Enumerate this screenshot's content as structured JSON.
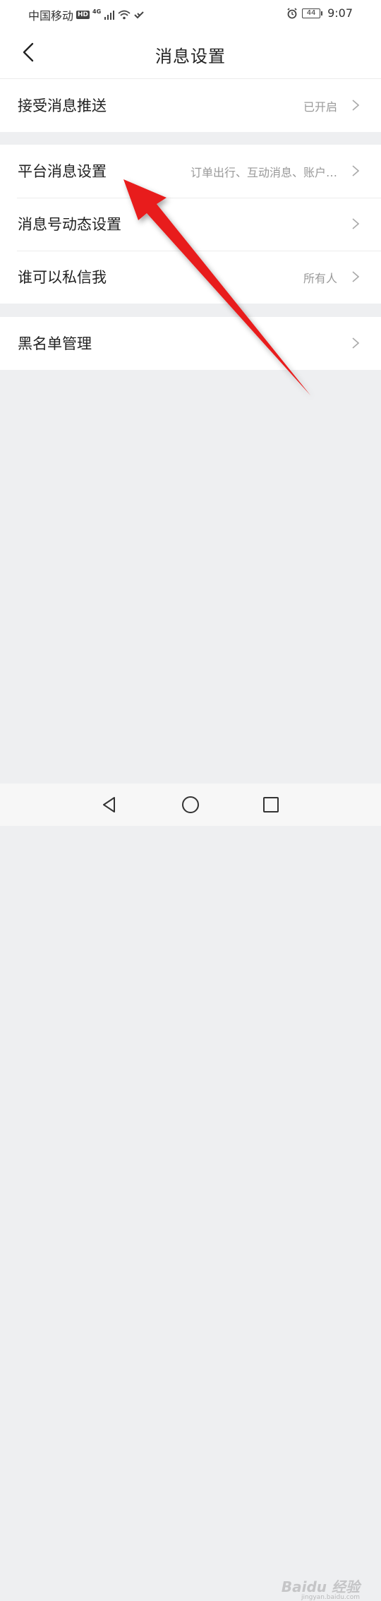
{
  "status_bar": {
    "carrier": "中国移动",
    "hd": "HD",
    "network": "4G",
    "battery": "44",
    "time": "9:07"
  },
  "header": {
    "title": "消息设置"
  },
  "groups": [
    {
      "items": [
        {
          "label": "接受消息推送",
          "value": "已开启"
        }
      ]
    },
    {
      "items": [
        {
          "label": "平台消息设置",
          "value": "订单出行、互动消息、账户…"
        },
        {
          "label": "消息号动态设置",
          "value": ""
        },
        {
          "label": "谁可以私信我",
          "value": "所有人"
        }
      ]
    },
    {
      "items": [
        {
          "label": "黑名单管理",
          "value": ""
        }
      ]
    }
  ],
  "watermark": {
    "brand": "Baidu 经验",
    "url": "jingyan.baidu.com"
  },
  "colors": {
    "annotation_arrow": "#e81c1c",
    "page_background": "#eeeff1"
  }
}
